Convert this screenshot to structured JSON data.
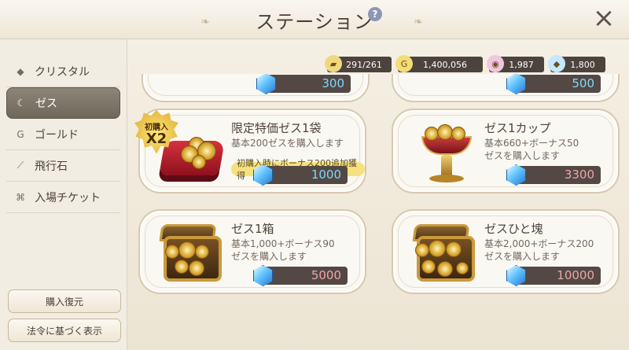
{
  "header": {
    "title": "ステーション",
    "help": "?",
    "close": "×"
  },
  "sidebar": {
    "items": [
      {
        "label": "クリスタル",
        "icon": "crystal-icon",
        "active": false
      },
      {
        "label": "ゼス",
        "icon": "zes-icon",
        "active": true
      },
      {
        "label": "ゴールド",
        "icon": "gold-icon",
        "active": false
      },
      {
        "label": "飛行石",
        "icon": "flying-stone-icon",
        "active": false
      },
      {
        "label": "入場チケット",
        "icon": "ticket-icon",
        "active": false
      }
    ],
    "buttons": {
      "restore": "購入復元",
      "legal": "法令に基づく表示"
    }
  },
  "resources": [
    {
      "value": "291/261",
      "icon": "ticket-icon"
    },
    {
      "value": "1,400,056",
      "icon": "gold-coin-icon"
    },
    {
      "value": "1,987",
      "icon": "pink-gem-icon"
    },
    {
      "value": "1,800",
      "icon": "blue-gem-icon"
    }
  ],
  "top_partial": {
    "left_price": "300",
    "right_price": "500"
  },
  "cards": [
    {
      "title": "限定特価ゼス1袋",
      "desc": "基本200ゼスを購入します",
      "bonus": "初購入時にボーナス200追加獲得",
      "price": "1000",
      "theme": "blue",
      "badge_top": "初購入",
      "badge_main": "X2"
    },
    {
      "title": "ゼス1カップ",
      "desc1": "基本660+ボーナス50",
      "desc2": "ゼスを購入します",
      "price": "3300",
      "theme": "pink"
    },
    {
      "title": "ゼス1箱",
      "desc1": "基本1,000+ボーナス90",
      "desc2": "ゼスを購入します",
      "price": "5000",
      "theme": "pink"
    },
    {
      "title": "ゼスひと塊",
      "desc1": "基本2,000+ボーナス200",
      "desc2": "ゼスを購入します",
      "price": "10000",
      "theme": "pink"
    }
  ]
}
